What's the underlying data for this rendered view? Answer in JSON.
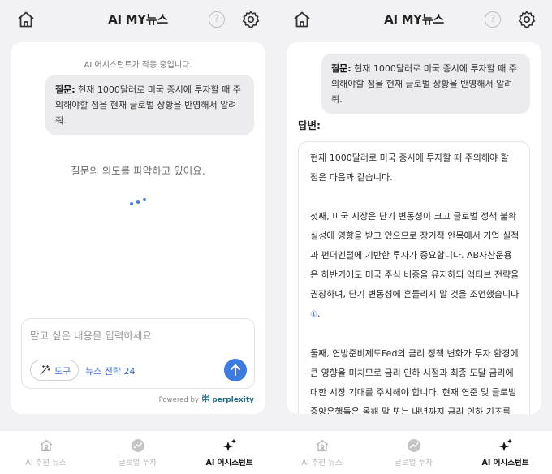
{
  "header": {
    "title": "AI MY뉴스",
    "help_glyph": "?"
  },
  "left": {
    "status": "AI 어시스턴트가 작동 중입니다.",
    "question": {
      "prefix": "질문:",
      "text": " 현재 1000달러로 미국 증시에 투자할 때 주의해야할 점을 현재 글로벌 상황을 반영해서 알려줘."
    },
    "intent": "질문의 의도를 파악하고 있어요.",
    "input": {
      "placeholder": "말고 싶은 내용을 입력하세요",
      "tool_label": "도구",
      "strategy_label": "뉴스 전략 24"
    },
    "powered_by": {
      "prefix": "Powered by",
      "brand": "perplexity"
    }
  },
  "right": {
    "question": {
      "prefix": "질문:",
      "text": " 현재 1000달러로 미국 증시에 투자할 때 주의해야할 점을 현재 글로벌 상황을 반영해서 알려줘."
    },
    "answer_label": "답변:",
    "answer": {
      "p1": "현재 1000달러로 미국 증시에 투자할 때 주의해야 할 점은 다음과 같습니다.",
      "p2": "첫째, 미국 시장은 단기 변동성이 크고 글로벌 정책 불확실성에 영향을 받고 있으므로 장기적 안목에서 기업 실적과 펀더멘털에 기반한 투자가 중요합니다. AB자산운용은 하반기에도 미국 주식 비중을 유지하되 액티브 전략을 권장하며, 단기 변동성에 흔들리지 말 것을 조언했습니다",
      "p2_cite": "①",
      "p2_end": ".",
      "p3": "둘째, 연방준비제도Fed의 금리 정책 변화가 투자 환경에 큰 영향을 미치므로 금리 인하 시점과 최종 도달 금리에 대한 시장 기대를 주시해야 합니다. 현재 연준 및 글로벌 중앙은행들은 올해 말 또는 내년까지 금리 인하 기조를 이어갈 것으로 전망되나, 최종 금리가 예"
    }
  },
  "tabs": [
    {
      "label": "AI 추천 뉴스",
      "icon": "home-news-icon",
      "active": false
    },
    {
      "label": "글로벌 투자",
      "icon": "trend-chart-icon",
      "active": false
    },
    {
      "label": "AI 어시스턴트",
      "icon": "sparkle-icon",
      "active": true
    }
  ],
  "colors": {
    "accent": "#3d7be0",
    "link": "#3b6fd4",
    "background": "#f2f2f4",
    "bubble": "#ececef"
  }
}
